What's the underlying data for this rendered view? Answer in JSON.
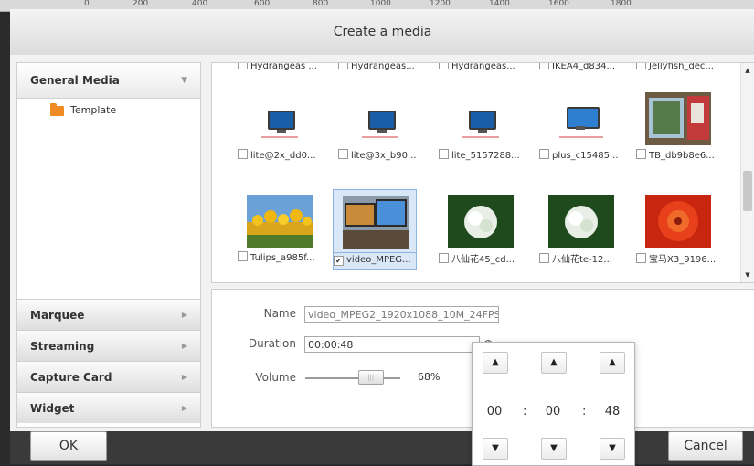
{
  "ruler": {
    "ticks": [
      "0",
      "200",
      "400",
      "600",
      "800",
      "1000",
      "1200",
      "1400",
      "1600",
      "1800"
    ]
  },
  "dialog": {
    "title": "Create a media"
  },
  "sidebar": {
    "header": "General Media",
    "tree": [
      {
        "label": "Template",
        "icon": "folder-icon"
      }
    ],
    "categories": [
      "Marquee",
      "Streaming",
      "Capture Card",
      "Widget"
    ]
  },
  "grid": {
    "rows": [
      [
        {
          "caption": "Hydrangeas ...",
          "checked": false,
          "thumb": "partial"
        },
        {
          "caption": "Hydrangeas...",
          "checked": false,
          "thumb": "partial"
        },
        {
          "caption": "Hydrangeas...",
          "checked": false,
          "thumb": "partial"
        },
        {
          "caption": "IKEA4_d834...",
          "checked": false,
          "thumb": "partial"
        },
        {
          "caption": "Jellyfish_dec...",
          "checked": false,
          "thumb": "partial"
        }
      ],
      [
        {
          "caption": "lite@2x_dd0...",
          "checked": false,
          "thumb": "monitor-icon"
        },
        {
          "caption": "lite@3x_b90...",
          "checked": false,
          "thumb": "monitor-icon"
        },
        {
          "caption": "lite_5157288...",
          "checked": false,
          "thumb": "monitor-icon"
        },
        {
          "caption": "plus_c15485...",
          "checked": false,
          "thumb": "monitor-plus-icon"
        },
        {
          "caption": "TB_db9b8e6...",
          "checked": false,
          "thumb": "photo-room"
        }
      ],
      [
        {
          "caption": "Tulips_a985f...",
          "checked": false,
          "thumb": "photo-tulips"
        },
        {
          "caption": "video_MPEG...",
          "checked": true,
          "thumb": "photo-monitors"
        },
        {
          "caption": "八仙花45_cd...",
          "checked": false,
          "thumb": "photo-flower-white"
        },
        {
          "caption": "八仙花te-12...",
          "checked": false,
          "thumb": "photo-flower-white"
        },
        {
          "caption": "宝马X3_9196...",
          "checked": false,
          "thumb": "photo-flower-red"
        }
      ]
    ]
  },
  "props": {
    "name_label": "Name",
    "name_value": "video_MPEG2_1920x1088_10M_24FPS",
    "duration_label": "Duration",
    "duration_value": "00:00:48",
    "volume_label": "Volume",
    "volume_percent": "68%",
    "volume_level": 0.68
  },
  "picker": {
    "hours": "00",
    "minutes": "00",
    "seconds": "48",
    "separator": ":",
    "up_glyph": "▲",
    "down_glyph": "▼"
  },
  "footer": {
    "ok_label": "OK",
    "cancel_label": "Cancel"
  }
}
